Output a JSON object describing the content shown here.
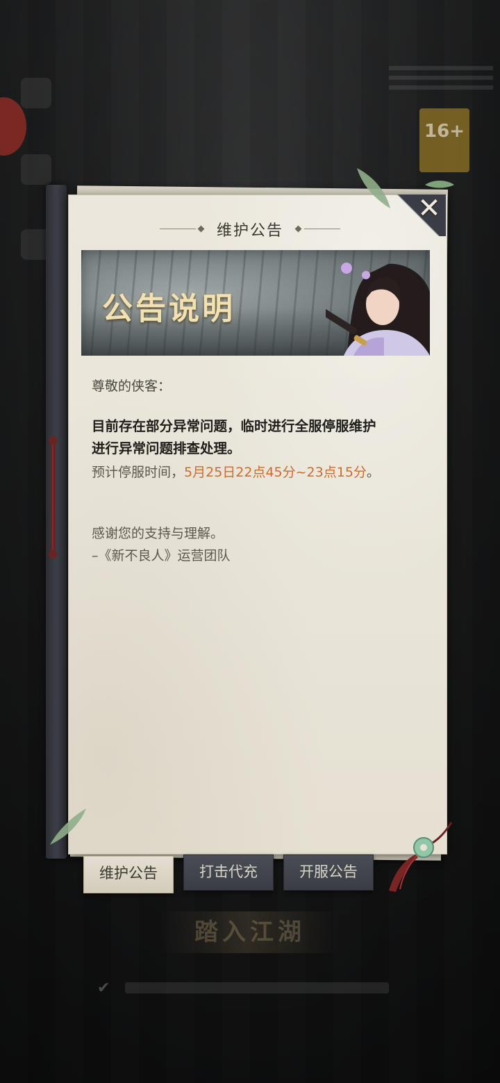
{
  "background": {
    "age_rating": "16+",
    "enter_button_label": "踏入江湖"
  },
  "panel": {
    "title": "维护公告",
    "banner_title": "公告说明",
    "close_icon": "close-icon"
  },
  "notice": {
    "greeting": "尊敬的侠客：",
    "line1": "目前存在部分异常问题，临时进行全服停服维护",
    "line2": "进行异常问题排查处理。",
    "line3_prefix": "预计停服时间，",
    "line3_highlight": "5月25日22点45分~23点15分",
    "line3_suffix": "。",
    "line4": "感谢您的支持与理解。",
    "line5": "–《新不良人》运营团队"
  },
  "tabs": [
    {
      "label": "维护公告",
      "active": true
    },
    {
      "label": "打击代充",
      "active": false
    },
    {
      "label": "开服公告",
      "active": false
    }
  ],
  "colors": {
    "highlight": "#d06a2a",
    "paper": "#e9e5da",
    "tab_inactive": "#42454c"
  }
}
